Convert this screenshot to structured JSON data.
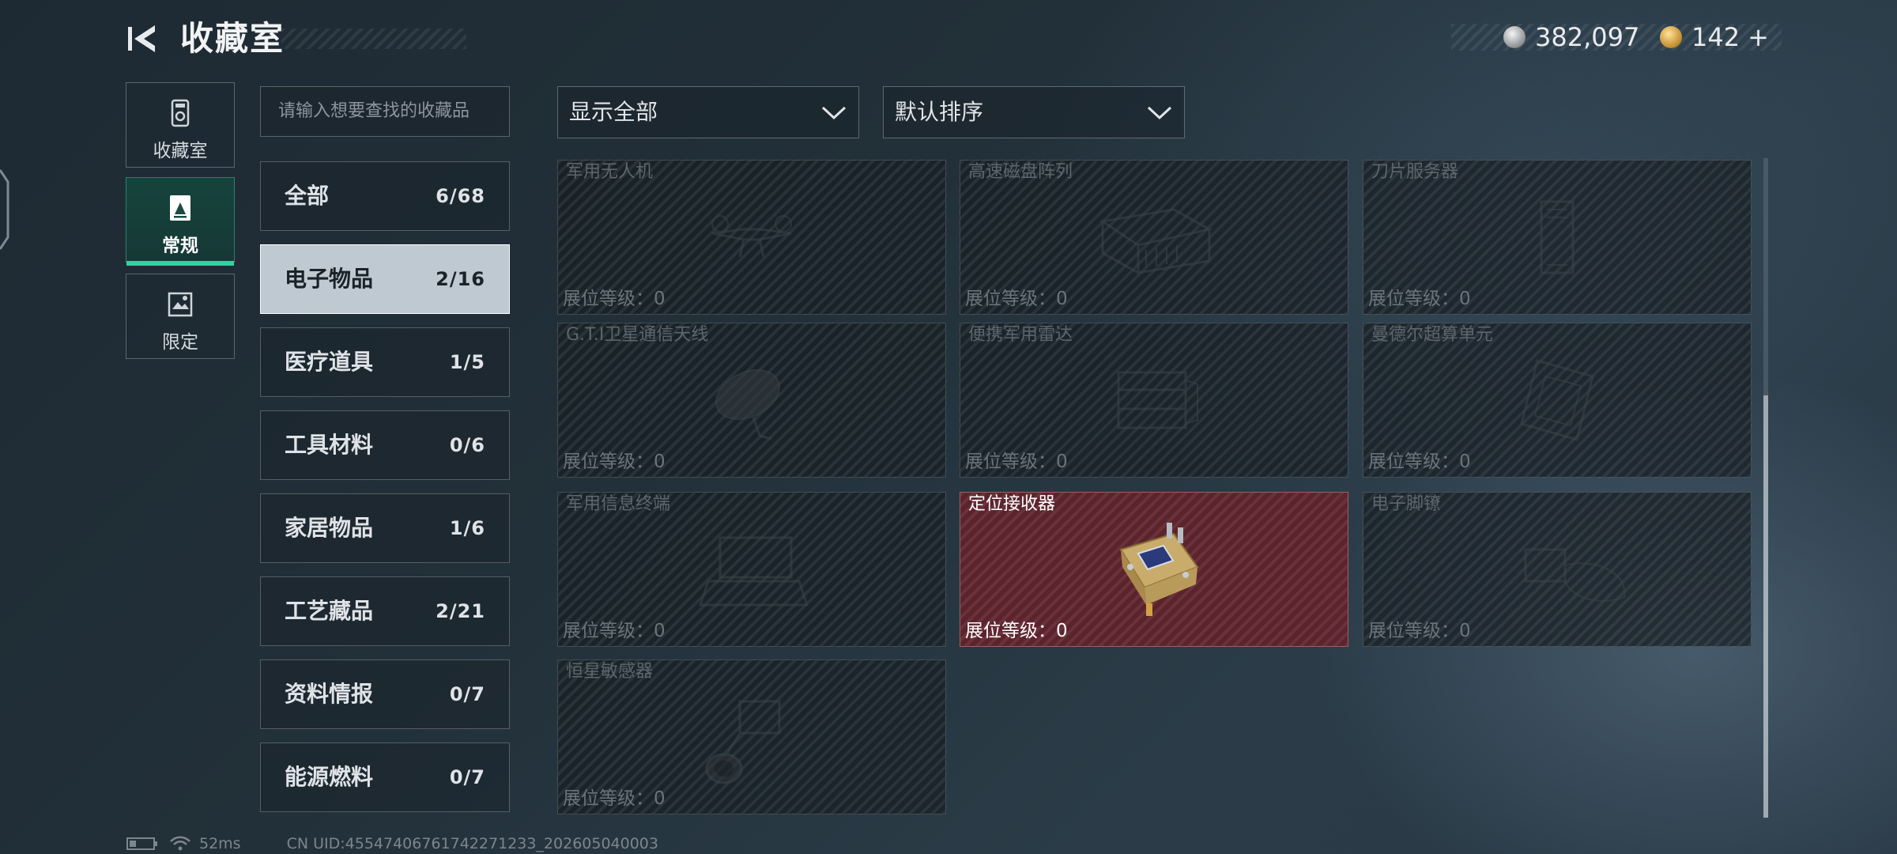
{
  "header": {
    "title": "收藏室",
    "currency": [
      {
        "icon": "silver-coin-icon",
        "value": "382,097"
      },
      {
        "icon": "gold-coin-icon",
        "value": "142"
      }
    ],
    "add_label": "+"
  },
  "left_nav": [
    {
      "label": "收藏室",
      "icon": "collection-room-icon",
      "active": false
    },
    {
      "label": "常规",
      "icon": "regular-collection-icon",
      "active": true
    },
    {
      "label": "限定",
      "icon": "limited-collection-icon",
      "active": false
    }
  ],
  "search": {
    "placeholder": "请输入想要查找的收藏品"
  },
  "categories": [
    {
      "name": "全部",
      "count": "6/68"
    },
    {
      "name": "电子物品",
      "count": "2/16",
      "active": true
    },
    {
      "name": "医疗道具",
      "count": "1/5"
    },
    {
      "name": "工具材料",
      "count": "0/6"
    },
    {
      "name": "家居物品",
      "count": "1/6"
    },
    {
      "name": "工艺藏品",
      "count": "2/21"
    },
    {
      "name": "资料情报",
      "count": "0/7"
    },
    {
      "name": "能源燃料",
      "count": "0/7"
    }
  ],
  "filters": {
    "show": "显示全部",
    "sort": "默认排序"
  },
  "items": [
    {
      "name": "军用无人机",
      "level": "展位等级：0",
      "unlocked": false,
      "icon": "drone-icon"
    },
    {
      "name": "高速磁盘阵列",
      "level": "展位等级：0",
      "unlocked": false,
      "icon": "disk-array-icon"
    },
    {
      "name": "刀片服务器",
      "level": "展位等级：0",
      "unlocked": false,
      "icon": "blade-server-icon"
    },
    {
      "name": "G.T.I卫星通信天线",
      "level": "展位等级：0",
      "unlocked": false,
      "icon": "satellite-dish-icon"
    },
    {
      "name": "便携军用雷达",
      "level": "展位等级：0",
      "unlocked": false,
      "icon": "radar-icon"
    },
    {
      "name": "曼德尔超算单元",
      "level": "展位等级：0",
      "unlocked": false,
      "icon": "supercomputer-unit-icon"
    },
    {
      "name": "军用信息终端",
      "level": "展位等级：0",
      "unlocked": false,
      "icon": "info-terminal-icon"
    },
    {
      "name": "定位接收器",
      "level": "展位等级：0",
      "unlocked": true,
      "icon": "gps-receiver-icon"
    },
    {
      "name": "电子脚镣",
      "level": "展位等级：0",
      "unlocked": false,
      "icon": "ankle-monitor-icon"
    },
    {
      "name": "恒星敏感器",
      "level": "展位等级：0",
      "unlocked": false,
      "icon": "star-sensor-icon"
    }
  ],
  "status": {
    "ping": "52ms",
    "uid": "CN UID:45547406761742271233_202605040003"
  },
  "colors": {
    "accent": "#2fd3a0",
    "unlocked_card": "#62222a",
    "active_category": "#cdd7de"
  }
}
